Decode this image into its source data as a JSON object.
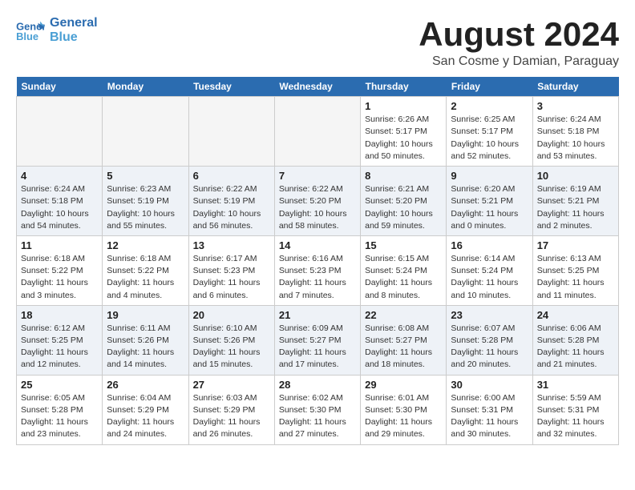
{
  "header": {
    "logo_line1": "General",
    "logo_line2": "Blue",
    "title": "August 2024",
    "subtitle": "San Cosme y Damian, Paraguay"
  },
  "columns": [
    "Sunday",
    "Monday",
    "Tuesday",
    "Wednesday",
    "Thursday",
    "Friday",
    "Saturday"
  ],
  "weeks": [
    [
      {
        "day": "",
        "info": "",
        "empty": true
      },
      {
        "day": "",
        "info": "",
        "empty": true
      },
      {
        "day": "",
        "info": "",
        "empty": true
      },
      {
        "day": "",
        "info": "",
        "empty": true
      },
      {
        "day": "1",
        "info": "Sunrise: 6:26 AM\nSunset: 5:17 PM\nDaylight: 10 hours\nand 50 minutes."
      },
      {
        "day": "2",
        "info": "Sunrise: 6:25 AM\nSunset: 5:17 PM\nDaylight: 10 hours\nand 52 minutes."
      },
      {
        "day": "3",
        "info": "Sunrise: 6:24 AM\nSunset: 5:18 PM\nDaylight: 10 hours\nand 53 minutes."
      }
    ],
    [
      {
        "day": "4",
        "info": "Sunrise: 6:24 AM\nSunset: 5:18 PM\nDaylight: 10 hours\nand 54 minutes."
      },
      {
        "day": "5",
        "info": "Sunrise: 6:23 AM\nSunset: 5:19 PM\nDaylight: 10 hours\nand 55 minutes."
      },
      {
        "day": "6",
        "info": "Sunrise: 6:22 AM\nSunset: 5:19 PM\nDaylight: 10 hours\nand 56 minutes."
      },
      {
        "day": "7",
        "info": "Sunrise: 6:22 AM\nSunset: 5:20 PM\nDaylight: 10 hours\nand 58 minutes."
      },
      {
        "day": "8",
        "info": "Sunrise: 6:21 AM\nSunset: 5:20 PM\nDaylight: 10 hours\nand 59 minutes."
      },
      {
        "day": "9",
        "info": "Sunrise: 6:20 AM\nSunset: 5:21 PM\nDaylight: 11 hours\nand 0 minutes."
      },
      {
        "day": "10",
        "info": "Sunrise: 6:19 AM\nSunset: 5:21 PM\nDaylight: 11 hours\nand 2 minutes."
      }
    ],
    [
      {
        "day": "11",
        "info": "Sunrise: 6:18 AM\nSunset: 5:22 PM\nDaylight: 11 hours\nand 3 minutes."
      },
      {
        "day": "12",
        "info": "Sunrise: 6:18 AM\nSunset: 5:22 PM\nDaylight: 11 hours\nand 4 minutes."
      },
      {
        "day": "13",
        "info": "Sunrise: 6:17 AM\nSunset: 5:23 PM\nDaylight: 11 hours\nand 6 minutes."
      },
      {
        "day": "14",
        "info": "Sunrise: 6:16 AM\nSunset: 5:23 PM\nDaylight: 11 hours\nand 7 minutes."
      },
      {
        "day": "15",
        "info": "Sunrise: 6:15 AM\nSunset: 5:24 PM\nDaylight: 11 hours\nand 8 minutes."
      },
      {
        "day": "16",
        "info": "Sunrise: 6:14 AM\nSunset: 5:24 PM\nDaylight: 11 hours\nand 10 minutes."
      },
      {
        "day": "17",
        "info": "Sunrise: 6:13 AM\nSunset: 5:25 PM\nDaylight: 11 hours\nand 11 minutes."
      }
    ],
    [
      {
        "day": "18",
        "info": "Sunrise: 6:12 AM\nSunset: 5:25 PM\nDaylight: 11 hours\nand 12 minutes."
      },
      {
        "day": "19",
        "info": "Sunrise: 6:11 AM\nSunset: 5:26 PM\nDaylight: 11 hours\nand 14 minutes."
      },
      {
        "day": "20",
        "info": "Sunrise: 6:10 AM\nSunset: 5:26 PM\nDaylight: 11 hours\nand 15 minutes."
      },
      {
        "day": "21",
        "info": "Sunrise: 6:09 AM\nSunset: 5:27 PM\nDaylight: 11 hours\nand 17 minutes."
      },
      {
        "day": "22",
        "info": "Sunrise: 6:08 AM\nSunset: 5:27 PM\nDaylight: 11 hours\nand 18 minutes."
      },
      {
        "day": "23",
        "info": "Sunrise: 6:07 AM\nSunset: 5:28 PM\nDaylight: 11 hours\nand 20 minutes."
      },
      {
        "day": "24",
        "info": "Sunrise: 6:06 AM\nSunset: 5:28 PM\nDaylight: 11 hours\nand 21 minutes."
      }
    ],
    [
      {
        "day": "25",
        "info": "Sunrise: 6:05 AM\nSunset: 5:28 PM\nDaylight: 11 hours\nand 23 minutes."
      },
      {
        "day": "26",
        "info": "Sunrise: 6:04 AM\nSunset: 5:29 PM\nDaylight: 11 hours\nand 24 minutes."
      },
      {
        "day": "27",
        "info": "Sunrise: 6:03 AM\nSunset: 5:29 PM\nDaylight: 11 hours\nand 26 minutes."
      },
      {
        "day": "28",
        "info": "Sunrise: 6:02 AM\nSunset: 5:30 PM\nDaylight: 11 hours\nand 27 minutes."
      },
      {
        "day": "29",
        "info": "Sunrise: 6:01 AM\nSunset: 5:30 PM\nDaylight: 11 hours\nand 29 minutes."
      },
      {
        "day": "30",
        "info": "Sunrise: 6:00 AM\nSunset: 5:31 PM\nDaylight: 11 hours\nand 30 minutes."
      },
      {
        "day": "31",
        "info": "Sunrise: 5:59 AM\nSunset: 5:31 PM\nDaylight: 11 hours\nand 32 minutes."
      }
    ]
  ]
}
